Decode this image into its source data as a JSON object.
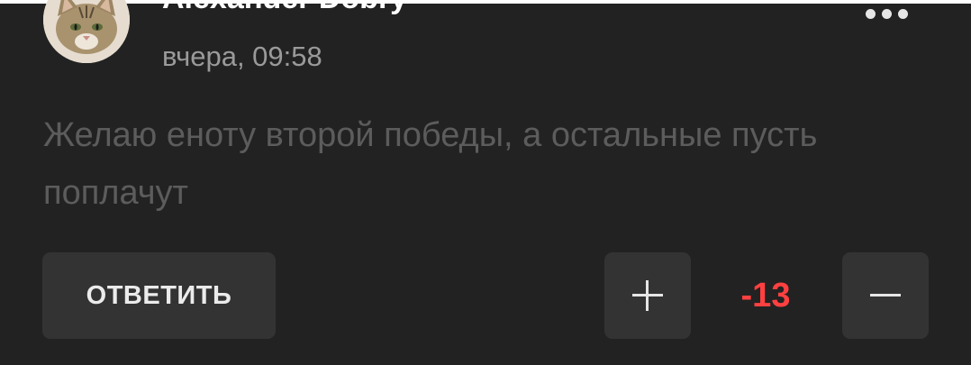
{
  "comment": {
    "author": "Alexander Dobry",
    "timestamp": "вчера, 09:58",
    "text": "Желаю еноту второй победы, а остальные пусть поплачут",
    "avatar_icon": "cat-avatar-icon",
    "more_icon": "more-dots-icon"
  },
  "actions": {
    "reply_label": "ОТВЕТИТЬ",
    "upvote_icon": "plus-icon",
    "downvote_icon": "minus-icon",
    "score": "-13"
  },
  "colors": {
    "background": "#222222",
    "button_bg": "#333333",
    "score_negative": "#ff4040",
    "muted_text": "#5c5c5c",
    "timestamp_text": "#9a9a9a"
  }
}
